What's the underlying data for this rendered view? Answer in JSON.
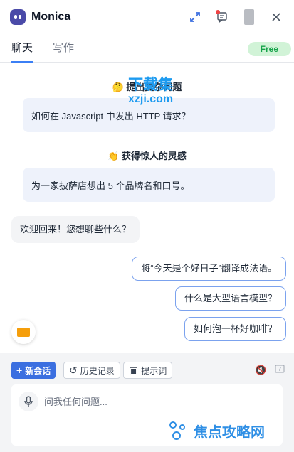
{
  "app": {
    "title": "Monica"
  },
  "colors": {
    "accent": "#3b6fe0",
    "free_badge_bg": "#d1f3d7",
    "free_badge_text": "#16a34a",
    "card_bg": "#eef2fb"
  },
  "header_icons": [
    "expand-icon",
    "feedback-icon",
    "user-avatar",
    "close-icon"
  ],
  "tabs": [
    {
      "label": "聊天"
    },
    {
      "label": "写作"
    }
  ],
  "badge": {
    "label": "Free"
  },
  "sections": [
    {
      "icon": "thinking-emoji-icon",
      "title": "提出复杂问题",
      "prompt": "如何在 Javascript 中发出 HTTP 请求？"
    },
    {
      "icon": "clapping-emoji-icon",
      "title": "获得惊人的灵感",
      "prompt": "为一家披萨店想出 5 个品牌名和口号。"
    }
  ],
  "watermark": {
    "line1": "下载集",
    "line2": "xzji.com"
  },
  "welcome": "欢迎回来！您想聊些什么？",
  "suggestions": [
    "将“今天是个好日子”翻译成法语。",
    "什么是大型语言模型？",
    "如何泡一杯好咖啡？"
  ],
  "toolbar": {
    "new_chat": "新会话",
    "history": "历史记录",
    "prompts": "提示词"
  },
  "input": {
    "placeholder": "问我任何问题..."
  },
  "watermark2": {
    "text": "焦点攻略网"
  }
}
